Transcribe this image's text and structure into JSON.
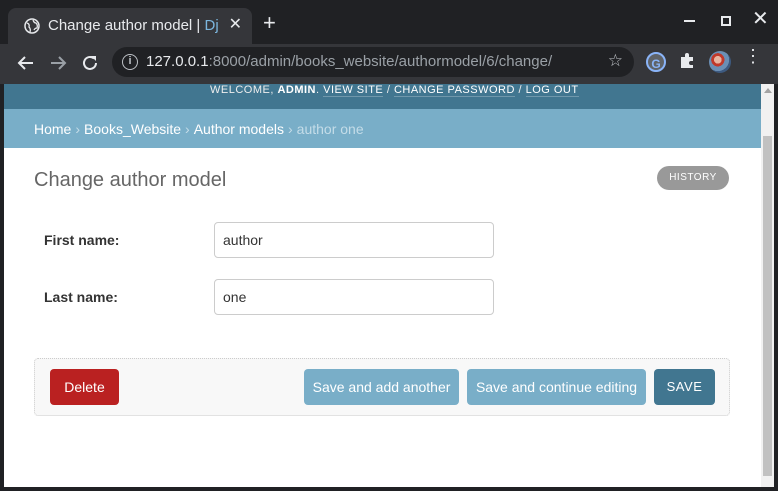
{
  "browser": {
    "tab": {
      "title": "Change author model | ",
      "title_fade": "Dj"
    },
    "new_tab_label": "+",
    "close_tab_label": "✕",
    "url": {
      "host": "127.0.0.1",
      "rest": ":8000/admin/books_website/authormodel/6/change/"
    },
    "extension_label": "G",
    "star_label": "☆",
    "kebab_label": "⋮",
    "window_close_label": "✕",
    "icons": [
      "globe-icon",
      "back-icon",
      "forward-icon",
      "reload-icon",
      "info-icon",
      "star-icon",
      "puzzle-icon",
      "menu-icon"
    ]
  },
  "header": {
    "welcome": "Welcome, ",
    "username": "admin",
    "view_site": "View site",
    "change_password": "Change password",
    "log_out": "Log out",
    "sep1": ". ",
    "sep2": " / ",
    "sep3": " / "
  },
  "breadcrumbs": {
    "home": "Home",
    "app": "Books_Website",
    "model": "Author models",
    "current": "author one",
    "sep": "›"
  },
  "page": {
    "title": "Change author model",
    "history_label": "History"
  },
  "form": {
    "first_name": {
      "label": "First name:",
      "value": "author"
    },
    "last_name": {
      "label": "Last name:",
      "value": "one"
    }
  },
  "actions": {
    "delete": "Delete",
    "save_add_another": "Save and add another",
    "save_continue": "Save and continue editing",
    "save": "Save"
  },
  "colors": {
    "header": "#417690",
    "breadcrumbs": "#79aec8",
    "delete": "#ba2121",
    "primary": "#417690",
    "secondary": "#79aec8"
  }
}
